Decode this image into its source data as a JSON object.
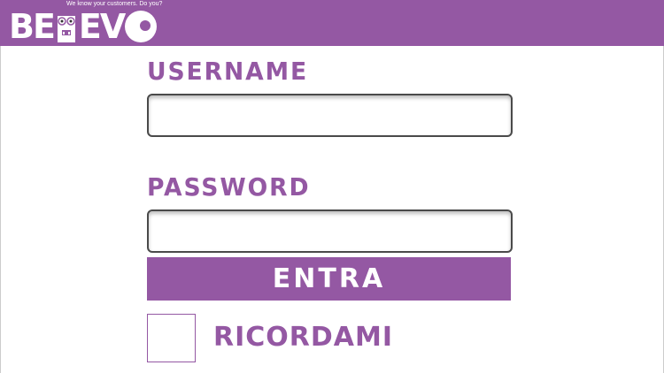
{
  "header": {
    "logo_text_left": "BE",
    "logo_text_right": "EV",
    "tagline": "We know your customers. Do you?",
    "brand_color": "#9458a3"
  },
  "form": {
    "username_label": "USERNAME",
    "username_value": "",
    "password_label": "PASSWORD",
    "password_value": "",
    "enter_label": "ENTRA",
    "remember_label": "RICORDAMI",
    "remember_checked": false
  }
}
